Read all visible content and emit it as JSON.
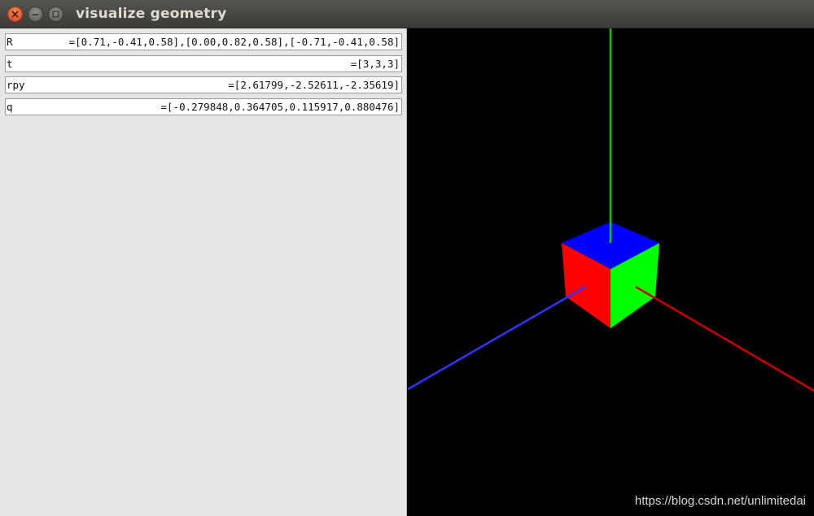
{
  "window": {
    "title": "visualize geometry"
  },
  "panel": {
    "fields": [
      {
        "label": "R",
        "value": "=[0.71,-0.41,0.58],[0.00,0.82,0.58],[-0.71,-0.41,0.58]"
      },
      {
        "label": "t",
        "value": "=[3,3,3]"
      },
      {
        "label": "rpy",
        "value": "=[2.61799,-2.52611,-2.35619]"
      },
      {
        "label": "q",
        "value": "=[-0.279848,0.364705,0.115917,0.880476]"
      }
    ]
  },
  "viewport": {
    "axes": {
      "x_color": "#cc0000",
      "y_color": "#00cc00",
      "z_color": "#3333ff"
    },
    "cube_faces": {
      "top": "#0000ff",
      "left": "#ff0000",
      "right": "#00ff00"
    }
  },
  "watermark": "https://blog.csdn.net/unlimitedai"
}
